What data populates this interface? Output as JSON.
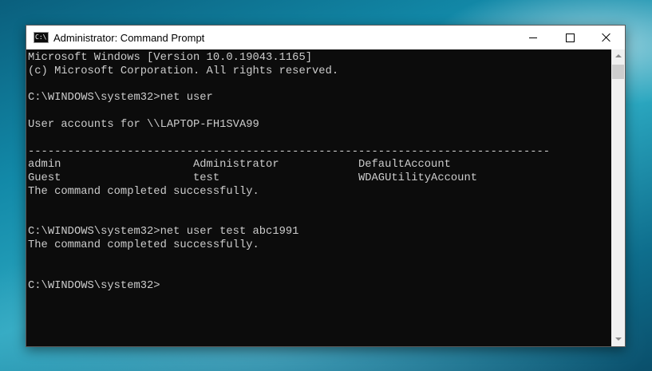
{
  "window": {
    "title": "Administrator: Command Prompt",
    "icon": "cmd-icon",
    "icon_text": "C:\\",
    "controls": [
      "minimize-icon",
      "maximize-icon",
      "close-icon"
    ]
  },
  "console": {
    "lines": [
      "Microsoft Windows [Version 10.0.19043.1165]",
      "(c) Microsoft Corporation. All rights reserved.",
      "",
      "C:\\WINDOWS\\system32>net user",
      "",
      "User accounts for \\\\LAPTOP-FH1SVA99",
      "",
      "-------------------------------------------------------------------------------",
      "admin                    Administrator            DefaultAccount",
      "Guest                    test                     WDAGUtilityAccount",
      "The command completed successfully.",
      "",
      "",
      "C:\\WINDOWS\\system32>net user test abc1991",
      "The command completed successfully.",
      "",
      "",
      "C:\\WINDOWS\\system32>"
    ]
  },
  "colors": {
    "console_background": "#0c0c0c",
    "console_text": "#cccccc",
    "titlebar": "#ffffff"
  }
}
